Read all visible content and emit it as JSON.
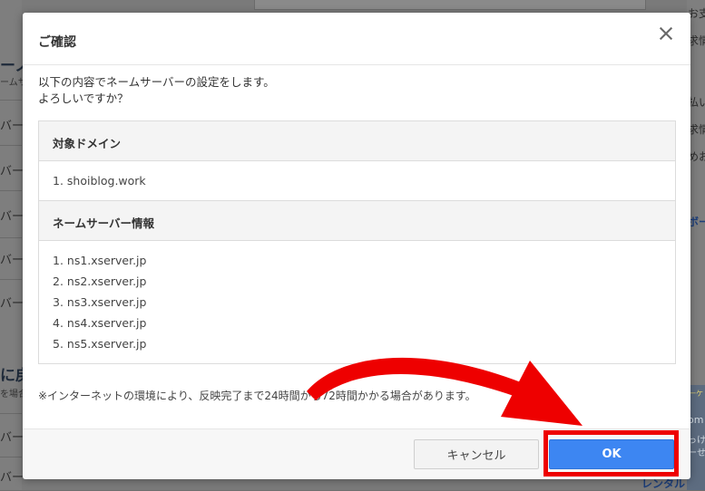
{
  "background": {
    "left_fragments": [
      "ーノ",
      "ームサ",
      "バー",
      "バー",
      "バー",
      "バー",
      "バー",
      "に戻て",
      "を場合",
      "バー",
      "バー"
    ],
    "right_fragments": [
      "お支払",
      "求情",
      "払い",
      "求情",
      "めお",
      "ボー",
      "一ケ",
      "om",
      "っけ",
      "ーせ",
      "レンタル"
    ]
  },
  "modal": {
    "title": "ご確認",
    "message_line1": "以下の内容でネームサーバーの設定をします。",
    "message_line2": "よろしいですか？",
    "domain_section": {
      "heading": "対象ドメイン",
      "items": [
        "1. shoiblog.work"
      ]
    },
    "ns_section": {
      "heading": "ネームサーバー情報",
      "items": [
        "1. ns1.xserver.jp",
        "2. ns2.xserver.jp",
        "3. ns3.xserver.jp",
        "4. ns4.xserver.jp",
        "5. ns5.xserver.jp"
      ]
    },
    "note": "※インターネットの環境により、反映完了まで24時間から72時間かかる場合があります。",
    "cancel_label": "キャンセル",
    "ok_label": "OK"
  },
  "colors": {
    "ok_button": "#3d86f2",
    "highlight": "#ee0000",
    "overlay": "#7a7a7a"
  },
  "icons": {
    "close": "close-icon",
    "annotation_arrow": "red-arrow-icon"
  }
}
